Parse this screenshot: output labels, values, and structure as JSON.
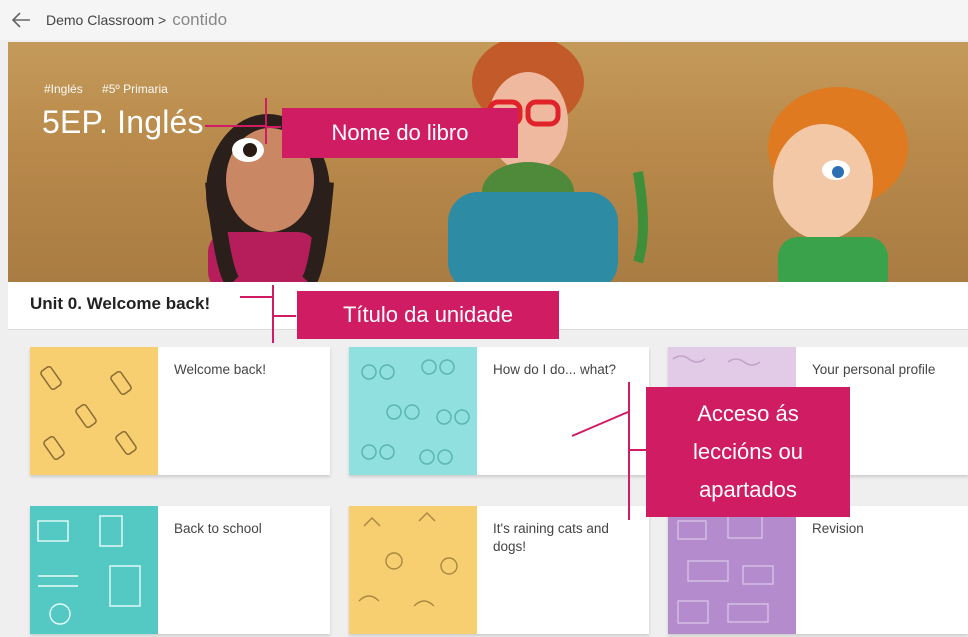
{
  "breadcrumb": {
    "parent": "Demo Classroom >",
    "current": "contido"
  },
  "hero": {
    "tags": [
      "#Inglés",
      "#5º Primaria"
    ],
    "title": "5EP. Inglés"
  },
  "unit": {
    "title": "Unit 0. Welcome back!"
  },
  "cards": [
    {
      "label": "Welcome back!",
      "color": "#f7cf71"
    },
    {
      "label": "How do I do... what?",
      "color": "#8fe0de"
    },
    {
      "label": "Your personal profile",
      "color": "#e2cbe6"
    },
    {
      "label": "Back to school",
      "color": "#54c9c3"
    },
    {
      "label": "It's raining cats and dogs!",
      "color": "#f7cf71"
    },
    {
      "label": "Revision",
      "color": "#b48ccd"
    }
  ],
  "annotations": {
    "book_name": "Nome do libro",
    "unit_title": "Título da unidade",
    "access": [
      "Acceso ás",
      "leccións ou",
      "apartados"
    ]
  },
  "colors": {
    "accent": "#d01c63"
  }
}
